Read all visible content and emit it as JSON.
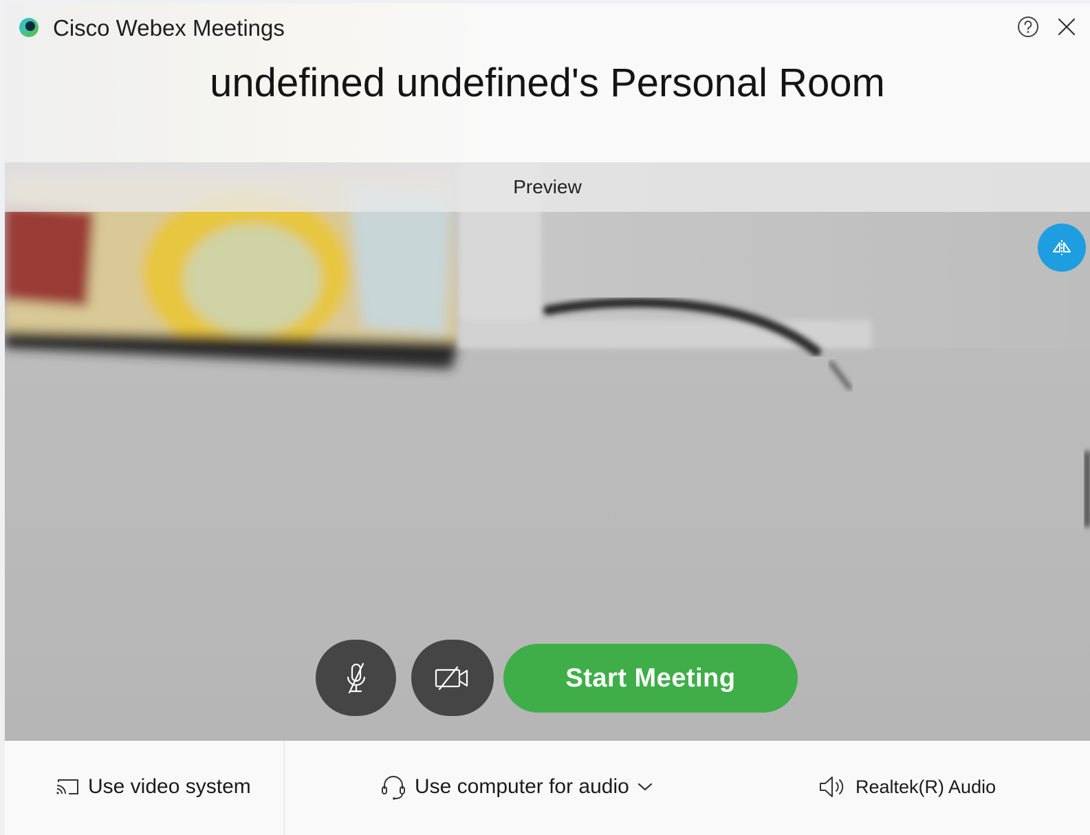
{
  "titlebar": {
    "app_title": "Cisco Webex Meetings",
    "help_icon": "help-circle-icon",
    "close_icon": "close-icon"
  },
  "meeting": {
    "room_title": "undefined undefined's Personal Room"
  },
  "preview": {
    "label": "Preview",
    "mirror_icon": "mirror-flip-icon",
    "mute_icon": "microphone-muted-icon",
    "video_icon": "camera-off-icon",
    "start_button_label": "Start Meeting"
  },
  "bottom_bar": {
    "video_system_label": "Use video system",
    "audio_option_label": "Use computer for audio",
    "speaker_label": "Realtek(R) Audio"
  },
  "colors": {
    "start_button": "#3fae49",
    "mirror_button": "#1e9ee0",
    "control_button": "#454545"
  }
}
